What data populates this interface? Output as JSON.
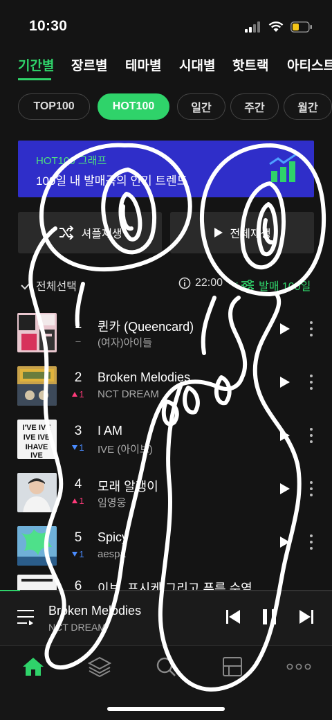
{
  "status_bar": {
    "time": "10:30"
  },
  "tabs": [
    "기간별",
    "장르별",
    "테마별",
    "시대별",
    "핫트랙",
    "아티스트"
  ],
  "chips": [
    "TOP100",
    "HOT100",
    "일간",
    "주간",
    "월간"
  ],
  "banner": {
    "title": "HOT100 그래프",
    "subtitle": "100일 내 발매곡의 인기 트렌드"
  },
  "actions": {
    "shuffle": "셔플재생",
    "play_all": "전체재생"
  },
  "list_header": {
    "select_all": "전체선택",
    "time": "22:00",
    "separator": "·",
    "filter": "발매 100일"
  },
  "songs": [
    {
      "rank": "1",
      "title": "퀸카 (Queencard)",
      "artist": "(여자)아이들",
      "change": "–",
      "dir": "same"
    },
    {
      "rank": "2",
      "title": "Broken Melodies",
      "artist": "NCT DREAM",
      "change": "1",
      "dir": "up"
    },
    {
      "rank": "3",
      "title": "I AM",
      "artist": "IVE (아이브)",
      "change": "1",
      "dir": "down"
    },
    {
      "rank": "4",
      "title": "모래 알갱이",
      "artist": "임영웅",
      "change": "1",
      "dir": "up"
    },
    {
      "rank": "5",
      "title": "Spicy",
      "artist": "aespa",
      "change": "1",
      "dir": "down"
    },
    {
      "rank": "6",
      "title": "이브, 프시케 그리고 푸른 수염…",
      "artist": "",
      "change": "",
      "dir": "same"
    }
  ],
  "player": {
    "title": "Broken Melodies",
    "artist": "NCT DREAM",
    "progress": 0.06
  },
  "icons": {
    "tabs": "none",
    "shuffle": "shuffle-icon",
    "play_all": "play-icon",
    "nav": [
      "home-icon",
      "layers-icon",
      "search-icon",
      "library-icon",
      "more-icon"
    ]
  },
  "colors": {
    "accent": "#2fd36a",
    "banner": "#2f2ec9",
    "up": "#ff3a7a",
    "down": "#4a8cff"
  }
}
